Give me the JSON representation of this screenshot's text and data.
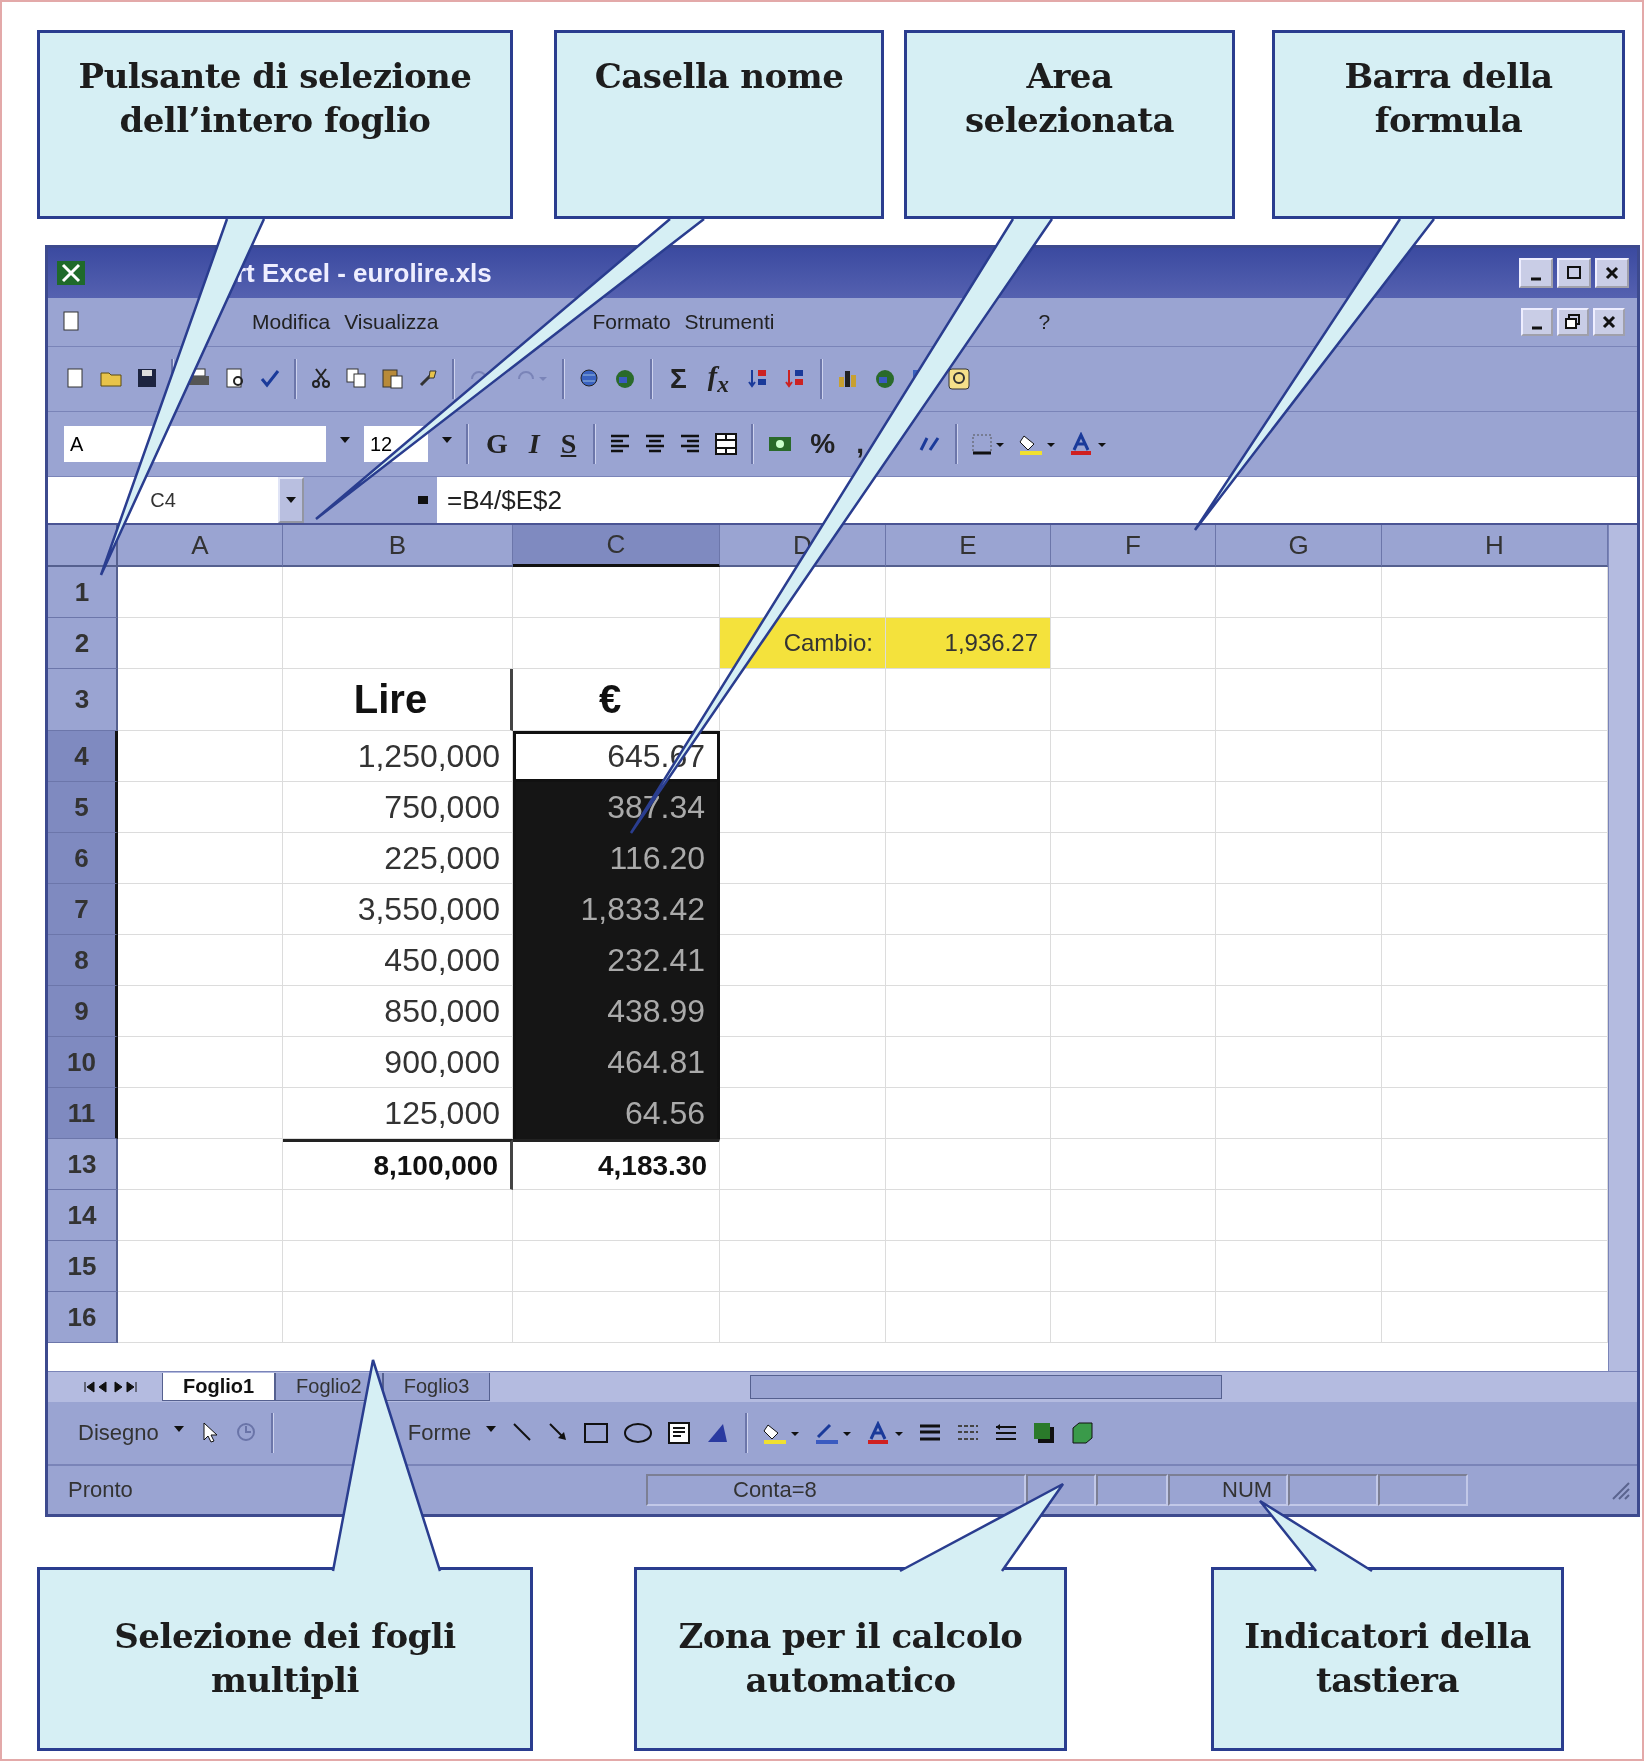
{
  "callouts_top": [
    "Pulsante di selezione dell’intero foglio",
    "Casella nome",
    "Area selezionata",
    "Barra della formula"
  ],
  "window": {
    "title": "rt Excel - eurolire.xls"
  },
  "menu": [
    "Modifica",
    "Visualizza",
    "Formato",
    "Strumenti",
    "?"
  ],
  "standard_toolbar": {
    "sum_button": "Σ",
    "function_button": "f$_{x}$"
  },
  "formatting_toolbar": {
    "font": "A",
    "size": "12",
    "style_buttons": [
      "G",
      "I",
      "S"
    ],
    "percent_button": "%",
    "comma_button": ","
  },
  "formula_bar": {
    "name_box": "C4",
    "formula": "=B4/$E$2"
  },
  "sheet": {
    "columns": [
      "A",
      "B",
      "C",
      "D",
      "E",
      "F",
      "G",
      "H"
    ],
    "rows": [
      {
        "number": "1",
        "kind": "normal",
        "cells": {}
      },
      {
        "number": "2",
        "kind": "normal",
        "cells": {
          "D": {
            "text": "Cambio:",
            "color": "#f4e23c"
          },
          "E": {
            "text": "1,936.27",
            "color": "#f4e23c"
          }
        }
      },
      {
        "number": "3",
        "kind": "heading",
        "cells": {
          "B": {
            "text": "Lire"
          },
          "C": {
            "text": "€"
          }
        }
      },
      {
        "number": "4",
        "kind": "normal",
        "cells": {
          "B": {
            "text": "1,250,000"
          },
          "C": {
            "text": "645.67",
            "selected": true,
            "active": true
          }
        }
      },
      {
        "number": "5",
        "kind": "normal",
        "cells": {
          "B": {
            "text": "750,000"
          },
          "C": {
            "text": "387.34",
            "selected": true,
            "active": false
          }
        }
      },
      {
        "number": "6",
        "kind": "normal",
        "cells": {
          "B": {
            "text": "225,000"
          },
          "C": {
            "text": "116.20",
            "selected": true,
            "active": false
          }
        }
      },
      {
        "number": "7",
        "kind": "normal",
        "cells": {
          "B": {
            "text": "3,550,000"
          },
          "C": {
            "text": "1,833.42",
            "selected": true,
            "active": false
          }
        }
      },
      {
        "number": "8",
        "kind": "normal",
        "cells": {
          "B": {
            "text": "450,000"
          },
          "C": {
            "text": "232.41",
            "selected": true,
            "active": false
          }
        }
      },
      {
        "number": "9",
        "kind": "normal",
        "cells": {
          "B": {
            "text": "850,000"
          },
          "C": {
            "text": "438.99",
            "selected": true,
            "active": false
          }
        }
      },
      {
        "number": "10",
        "kind": "normal",
        "cells": {
          "B": {
            "text": "900,000"
          },
          "C": {
            "text": "464.81",
            "selected": true,
            "active": false
          }
        }
      },
      {
        "number": "11",
        "kind": "normal",
        "cells": {
          "B": {
            "text": "125,000"
          },
          "C": {
            "text": "64.56",
            "selected": true,
            "active": false
          }
        }
      },
      {
        "number": "13",
        "kind": "total",
        "cells": {
          "B": {
            "text": "8,100,000"
          },
          "C": {
            "text": "4,183.30"
          }
        }
      },
      {
        "number": "14",
        "kind": "normal",
        "cells": {}
      },
      {
        "number": "15",
        "kind": "normal",
        "cells": {}
      },
      {
        "number": "16",
        "kind": "normal",
        "cells": {}
      }
    ]
  },
  "sheet_tabs": [
    {
      "label": "Foglio1",
      "selected": true
    },
    {
      "label": "Foglio2",
      "selected": false
    },
    {
      "label": "Foglio3",
      "selected": false
    }
  ],
  "drawing_toolbar": {
    "draw_menu": "Disegno",
    "shapes_menu": "Forme"
  },
  "status_bar": {
    "message": "Pronto",
    "auto_calc": "Conta=8",
    "indicator": "NUM"
  },
  "callouts_bottom": [
    "Selezione dei fogli multipli",
    "Zona per il calcolo automatico",
    "Indicatori della tastiera"
  ]
}
